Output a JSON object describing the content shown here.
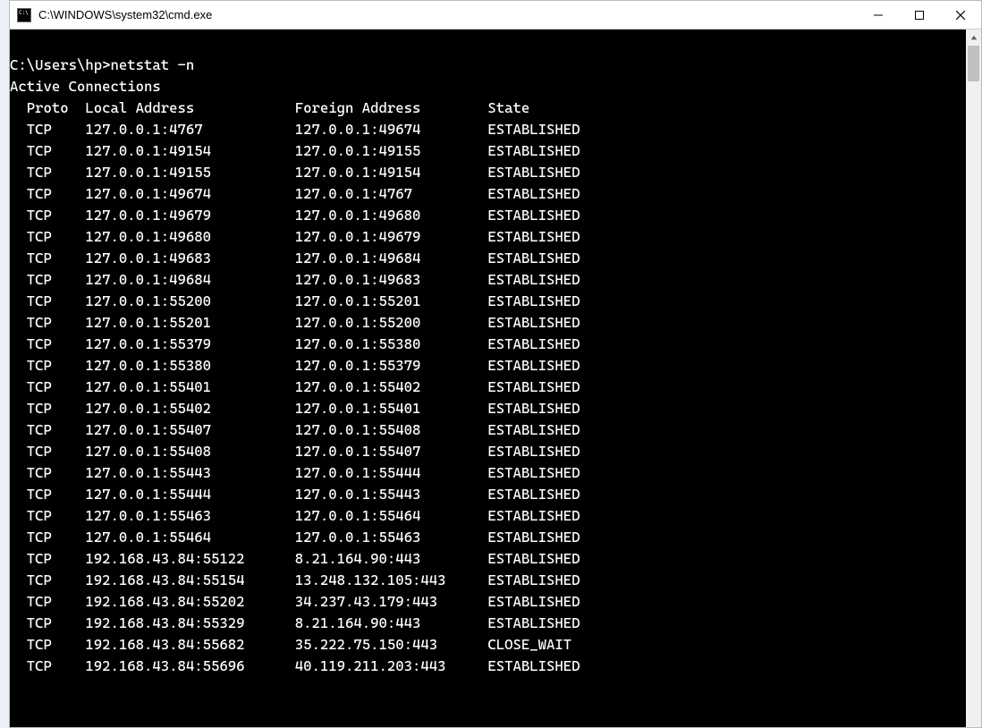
{
  "window": {
    "title": "C:\\WINDOWS\\system32\\cmd.exe"
  },
  "terminal": {
    "blank_line": " ",
    "prompt_line": "C:\\Users\\hp>netstat -n",
    "section_title": "Active Connections",
    "header": {
      "proto": "Proto",
      "local": "Local Address",
      "foreign": "Foreign Address",
      "state": "State"
    },
    "rows": [
      {
        "proto": "TCP",
        "local": "127.0.0.1:4767",
        "foreign": "127.0.0.1:49674",
        "state": "ESTABLISHED"
      },
      {
        "proto": "TCP",
        "local": "127.0.0.1:49154",
        "foreign": "127.0.0.1:49155",
        "state": "ESTABLISHED"
      },
      {
        "proto": "TCP",
        "local": "127.0.0.1:49155",
        "foreign": "127.0.0.1:49154",
        "state": "ESTABLISHED"
      },
      {
        "proto": "TCP",
        "local": "127.0.0.1:49674",
        "foreign": "127.0.0.1:4767",
        "state": "ESTABLISHED"
      },
      {
        "proto": "TCP",
        "local": "127.0.0.1:49679",
        "foreign": "127.0.0.1:49680",
        "state": "ESTABLISHED"
      },
      {
        "proto": "TCP",
        "local": "127.0.0.1:49680",
        "foreign": "127.0.0.1:49679",
        "state": "ESTABLISHED"
      },
      {
        "proto": "TCP",
        "local": "127.0.0.1:49683",
        "foreign": "127.0.0.1:49684",
        "state": "ESTABLISHED"
      },
      {
        "proto": "TCP",
        "local": "127.0.0.1:49684",
        "foreign": "127.0.0.1:49683",
        "state": "ESTABLISHED"
      },
      {
        "proto": "TCP",
        "local": "127.0.0.1:55200",
        "foreign": "127.0.0.1:55201",
        "state": "ESTABLISHED"
      },
      {
        "proto": "TCP",
        "local": "127.0.0.1:55201",
        "foreign": "127.0.0.1:55200",
        "state": "ESTABLISHED"
      },
      {
        "proto": "TCP",
        "local": "127.0.0.1:55379",
        "foreign": "127.0.0.1:55380",
        "state": "ESTABLISHED"
      },
      {
        "proto": "TCP",
        "local": "127.0.0.1:55380",
        "foreign": "127.0.0.1:55379",
        "state": "ESTABLISHED"
      },
      {
        "proto": "TCP",
        "local": "127.0.0.1:55401",
        "foreign": "127.0.0.1:55402",
        "state": "ESTABLISHED"
      },
      {
        "proto": "TCP",
        "local": "127.0.0.1:55402",
        "foreign": "127.0.0.1:55401",
        "state": "ESTABLISHED"
      },
      {
        "proto": "TCP",
        "local": "127.0.0.1:55407",
        "foreign": "127.0.0.1:55408",
        "state": "ESTABLISHED"
      },
      {
        "proto": "TCP",
        "local": "127.0.0.1:55408",
        "foreign": "127.0.0.1:55407",
        "state": "ESTABLISHED"
      },
      {
        "proto": "TCP",
        "local": "127.0.0.1:55443",
        "foreign": "127.0.0.1:55444",
        "state": "ESTABLISHED"
      },
      {
        "proto": "TCP",
        "local": "127.0.0.1:55444",
        "foreign": "127.0.0.1:55443",
        "state": "ESTABLISHED"
      },
      {
        "proto": "TCP",
        "local": "127.0.0.1:55463",
        "foreign": "127.0.0.1:55464",
        "state": "ESTABLISHED"
      },
      {
        "proto": "TCP",
        "local": "127.0.0.1:55464",
        "foreign": "127.0.0.1:55463",
        "state": "ESTABLISHED"
      },
      {
        "proto": "TCP",
        "local": "192.168.43.84:55122",
        "foreign": "8.21.164.90:443",
        "state": "ESTABLISHED"
      },
      {
        "proto": "TCP",
        "local": "192.168.43.84:55154",
        "foreign": "13.248.132.105:443",
        "state": "ESTABLISHED"
      },
      {
        "proto": "TCP",
        "local": "192.168.43.84:55202",
        "foreign": "34.237.43.179:443",
        "state": "ESTABLISHED"
      },
      {
        "proto": "TCP",
        "local": "192.168.43.84:55329",
        "foreign": "8.21.164.90:443",
        "state": "ESTABLISHED"
      },
      {
        "proto": "TCP",
        "local": "192.168.43.84:55682",
        "foreign": "35.222.75.150:443",
        "state": "CLOSE_WAIT"
      },
      {
        "proto": "TCP",
        "local": "192.168.43.84:55696",
        "foreign": "40.119.211.203:443",
        "state": "ESTABLISHED"
      }
    ]
  }
}
